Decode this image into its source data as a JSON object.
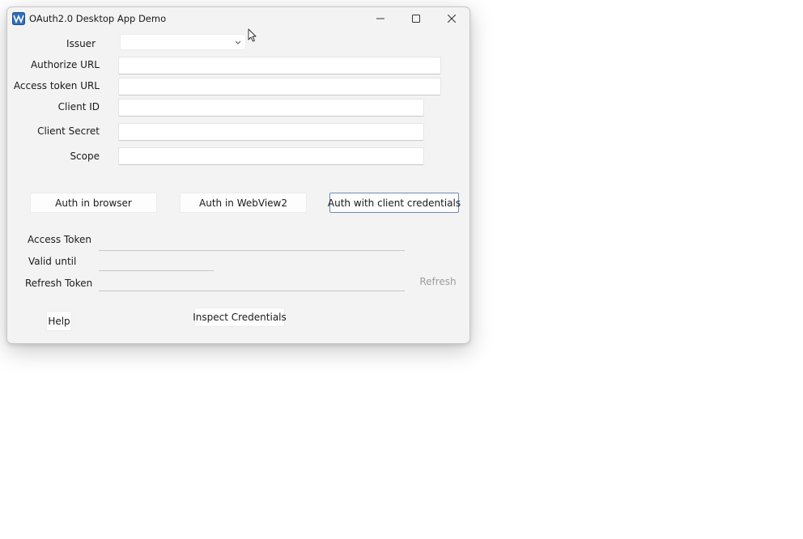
{
  "window": {
    "title": "OAuth2.0 Desktop App Demo",
    "icon": "app-logo-icon",
    "controls": [
      "minimize-icon",
      "maximize-icon",
      "close-icon"
    ]
  },
  "form": {
    "issuer_label": "Issuer",
    "issuer_value": "",
    "authorize_url_label": "Authorize URL",
    "authorize_url_value": "",
    "access_token_url_label": "Access token URL",
    "access_token_url_value": "",
    "client_id_label": "Client ID",
    "client_id_value": "",
    "client_secret_label": "Client Secret",
    "client_secret_value": "",
    "scope_label": "Scope",
    "scope_value": ""
  },
  "actions": {
    "auth_browser": "Auth in browser",
    "auth_webview": "Auth in WebView2",
    "auth_client_credentials": "Auth with client credentials"
  },
  "tokens": {
    "access_token_label": "Access Token",
    "access_token_value": "",
    "valid_until_label": "Valid until",
    "valid_until_value": "",
    "refresh_token_label": "Refresh Token",
    "refresh_token_value": "",
    "refresh_button": "Refresh"
  },
  "footer": {
    "help_button": "Help",
    "inspect_button": "Inspect Credentials"
  },
  "colors": {
    "window_bg": "#f3f3f3",
    "focus_border": "#6e88b4",
    "icon_blue": "#2f6fb7"
  }
}
